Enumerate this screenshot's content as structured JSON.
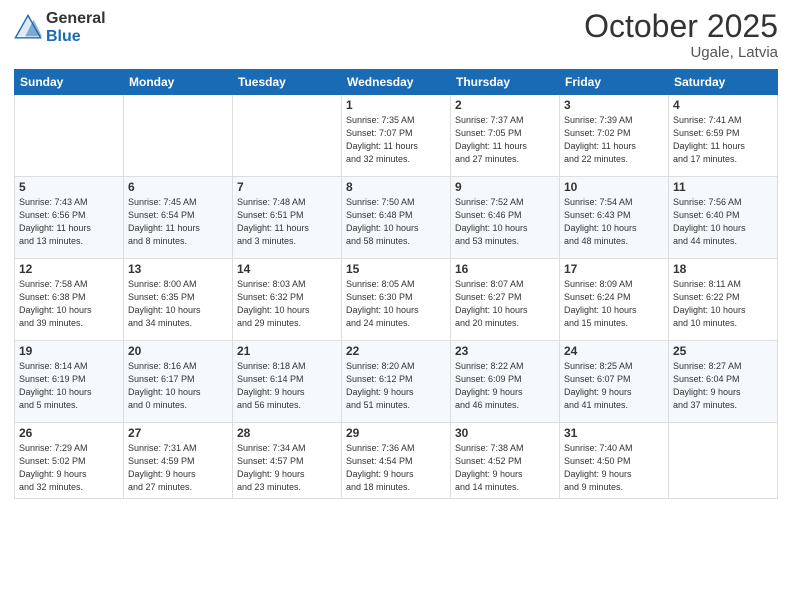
{
  "logo": {
    "general": "General",
    "blue": "Blue"
  },
  "title": "October 2025",
  "location": "Ugale, Latvia",
  "weekdays": [
    "Sunday",
    "Monday",
    "Tuesday",
    "Wednesday",
    "Thursday",
    "Friday",
    "Saturday"
  ],
  "weeks": [
    [
      {
        "day": "",
        "info": ""
      },
      {
        "day": "",
        "info": ""
      },
      {
        "day": "",
        "info": ""
      },
      {
        "day": "1",
        "info": "Sunrise: 7:35 AM\nSunset: 7:07 PM\nDaylight: 11 hours\nand 32 minutes."
      },
      {
        "day": "2",
        "info": "Sunrise: 7:37 AM\nSunset: 7:05 PM\nDaylight: 11 hours\nand 27 minutes."
      },
      {
        "day": "3",
        "info": "Sunrise: 7:39 AM\nSunset: 7:02 PM\nDaylight: 11 hours\nand 22 minutes."
      },
      {
        "day": "4",
        "info": "Sunrise: 7:41 AM\nSunset: 6:59 PM\nDaylight: 11 hours\nand 17 minutes."
      }
    ],
    [
      {
        "day": "5",
        "info": "Sunrise: 7:43 AM\nSunset: 6:56 PM\nDaylight: 11 hours\nand 13 minutes."
      },
      {
        "day": "6",
        "info": "Sunrise: 7:45 AM\nSunset: 6:54 PM\nDaylight: 11 hours\nand 8 minutes."
      },
      {
        "day": "7",
        "info": "Sunrise: 7:48 AM\nSunset: 6:51 PM\nDaylight: 11 hours\nand 3 minutes."
      },
      {
        "day": "8",
        "info": "Sunrise: 7:50 AM\nSunset: 6:48 PM\nDaylight: 10 hours\nand 58 minutes."
      },
      {
        "day": "9",
        "info": "Sunrise: 7:52 AM\nSunset: 6:46 PM\nDaylight: 10 hours\nand 53 minutes."
      },
      {
        "day": "10",
        "info": "Sunrise: 7:54 AM\nSunset: 6:43 PM\nDaylight: 10 hours\nand 48 minutes."
      },
      {
        "day": "11",
        "info": "Sunrise: 7:56 AM\nSunset: 6:40 PM\nDaylight: 10 hours\nand 44 minutes."
      }
    ],
    [
      {
        "day": "12",
        "info": "Sunrise: 7:58 AM\nSunset: 6:38 PM\nDaylight: 10 hours\nand 39 minutes."
      },
      {
        "day": "13",
        "info": "Sunrise: 8:00 AM\nSunset: 6:35 PM\nDaylight: 10 hours\nand 34 minutes."
      },
      {
        "day": "14",
        "info": "Sunrise: 8:03 AM\nSunset: 6:32 PM\nDaylight: 10 hours\nand 29 minutes."
      },
      {
        "day": "15",
        "info": "Sunrise: 8:05 AM\nSunset: 6:30 PM\nDaylight: 10 hours\nand 24 minutes."
      },
      {
        "day": "16",
        "info": "Sunrise: 8:07 AM\nSunset: 6:27 PM\nDaylight: 10 hours\nand 20 minutes."
      },
      {
        "day": "17",
        "info": "Sunrise: 8:09 AM\nSunset: 6:24 PM\nDaylight: 10 hours\nand 15 minutes."
      },
      {
        "day": "18",
        "info": "Sunrise: 8:11 AM\nSunset: 6:22 PM\nDaylight: 10 hours\nand 10 minutes."
      }
    ],
    [
      {
        "day": "19",
        "info": "Sunrise: 8:14 AM\nSunset: 6:19 PM\nDaylight: 10 hours\nand 5 minutes."
      },
      {
        "day": "20",
        "info": "Sunrise: 8:16 AM\nSunset: 6:17 PM\nDaylight: 10 hours\nand 0 minutes."
      },
      {
        "day": "21",
        "info": "Sunrise: 8:18 AM\nSunset: 6:14 PM\nDaylight: 9 hours\nand 56 minutes."
      },
      {
        "day": "22",
        "info": "Sunrise: 8:20 AM\nSunset: 6:12 PM\nDaylight: 9 hours\nand 51 minutes."
      },
      {
        "day": "23",
        "info": "Sunrise: 8:22 AM\nSunset: 6:09 PM\nDaylight: 9 hours\nand 46 minutes."
      },
      {
        "day": "24",
        "info": "Sunrise: 8:25 AM\nSunset: 6:07 PM\nDaylight: 9 hours\nand 41 minutes."
      },
      {
        "day": "25",
        "info": "Sunrise: 8:27 AM\nSunset: 6:04 PM\nDaylight: 9 hours\nand 37 minutes."
      }
    ],
    [
      {
        "day": "26",
        "info": "Sunrise: 7:29 AM\nSunset: 5:02 PM\nDaylight: 9 hours\nand 32 minutes."
      },
      {
        "day": "27",
        "info": "Sunrise: 7:31 AM\nSunset: 4:59 PM\nDaylight: 9 hours\nand 27 minutes."
      },
      {
        "day": "28",
        "info": "Sunrise: 7:34 AM\nSunset: 4:57 PM\nDaylight: 9 hours\nand 23 minutes."
      },
      {
        "day": "29",
        "info": "Sunrise: 7:36 AM\nSunset: 4:54 PM\nDaylight: 9 hours\nand 18 minutes."
      },
      {
        "day": "30",
        "info": "Sunrise: 7:38 AM\nSunset: 4:52 PM\nDaylight: 9 hours\nand 14 minutes."
      },
      {
        "day": "31",
        "info": "Sunrise: 7:40 AM\nSunset: 4:50 PM\nDaylight: 9 hours\nand 9 minutes."
      },
      {
        "day": "",
        "info": ""
      }
    ]
  ]
}
